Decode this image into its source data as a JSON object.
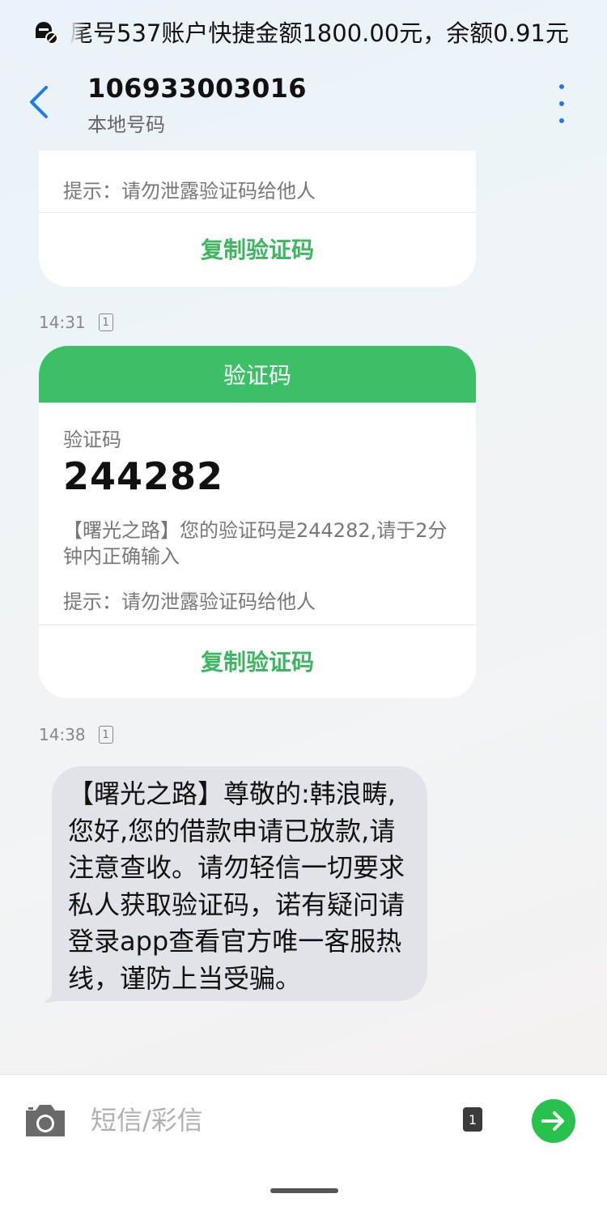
{
  "status_bar": {
    "notification_text": "尾号537账户快捷金额1800.00元，余额0.91元"
  },
  "header": {
    "contact_number": "106933003016",
    "contact_sub": "本地号码"
  },
  "messages": {
    "first_card": {
      "hint": "提示：请勿泄露验证码给他人",
      "copy_label": "复制验证码"
    },
    "otp_message": {
      "time": "14:31",
      "sim": "1",
      "header": "验证码",
      "code_label": "验证码",
      "code": "244282",
      "body": "【曙光之路】您的验证码是244282,请于2分钟内正确输入",
      "hint": "提示：请勿泄露验证码给他人",
      "copy_label": "复制验证码"
    },
    "text_message": {
      "time": "14:38",
      "sim": "1",
      "body": "【曙光之路】尊敬的:韩浪畴,您好,您的借款申请已放款,请注意查收。请勿轻信一切要求私人获取验证码，诺有疑问请登录app查看官方唯一客服热线，谨防上当受骗。"
    }
  },
  "composer": {
    "placeholder": "短信/彩信",
    "sim": "1"
  },
  "colors": {
    "accent_green": "#3dbf67",
    "send_green": "#27c24c",
    "link_blue": "#1f7be6"
  },
  "icons": {
    "notification": "message-block-icon",
    "back": "chevron-left-icon",
    "more": "more-vertical-icon",
    "camera": "camera-icon",
    "send": "arrow-right-icon"
  }
}
